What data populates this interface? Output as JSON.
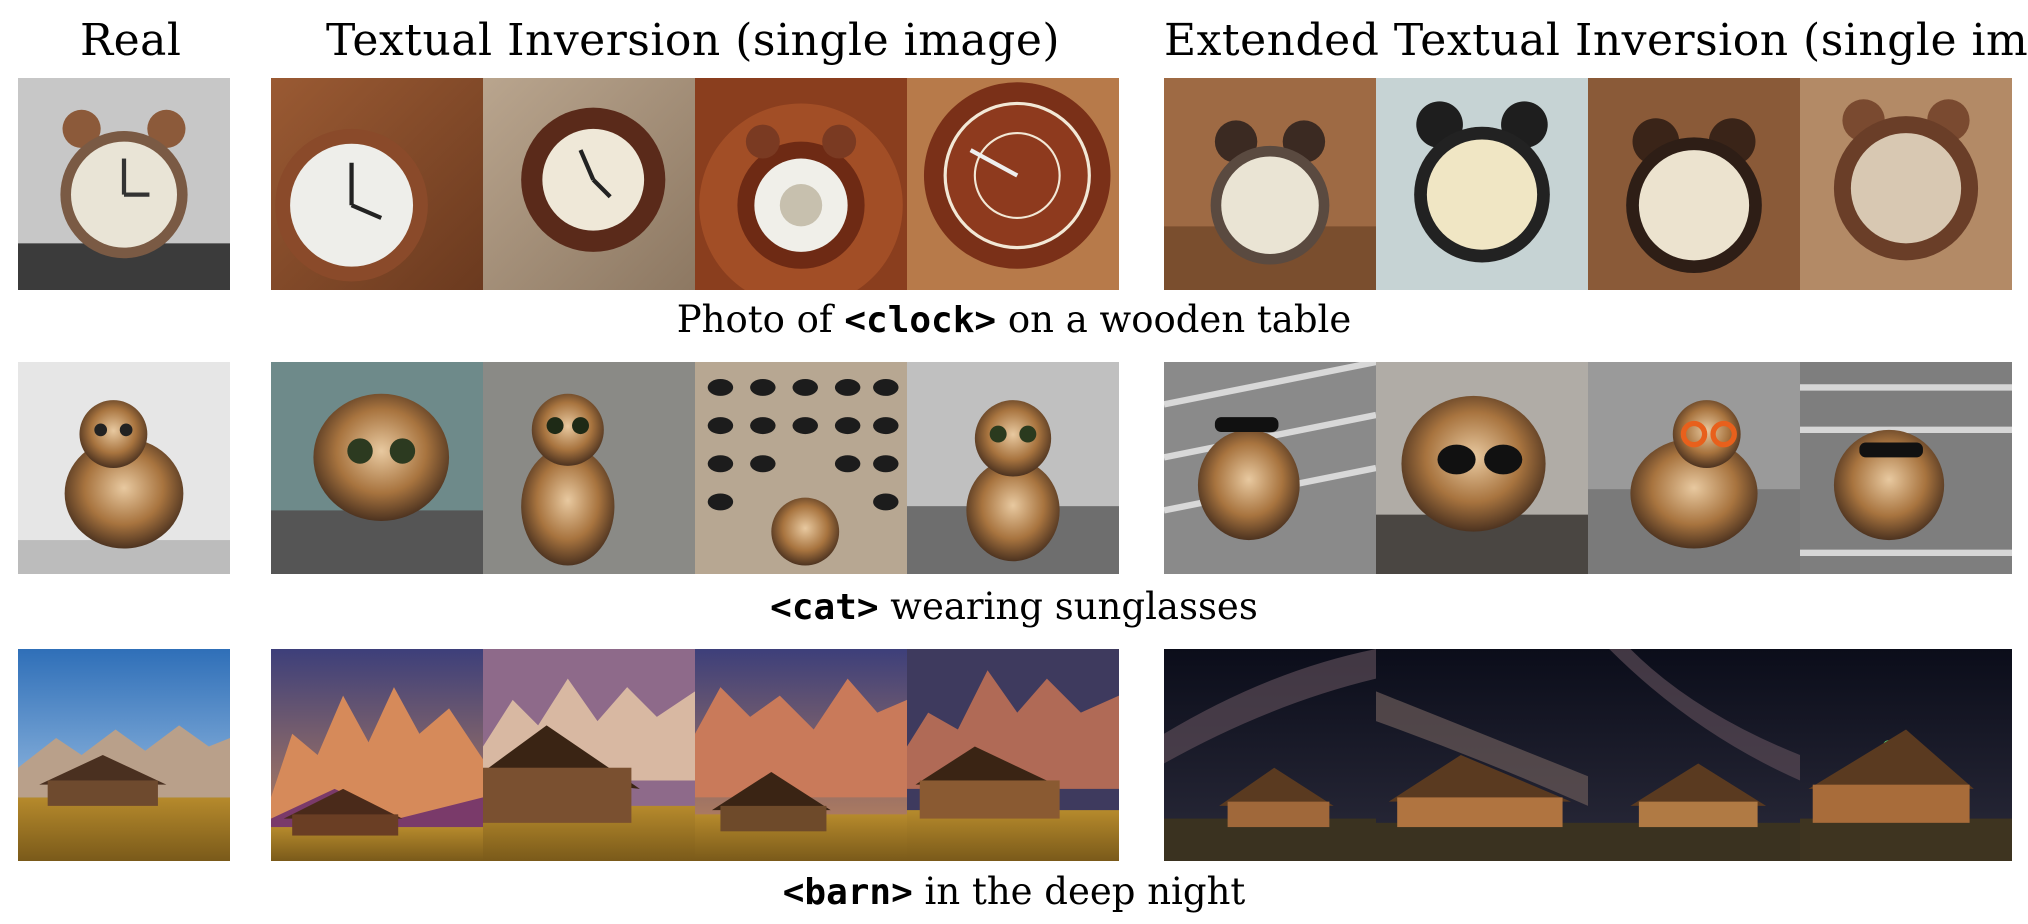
{
  "headers": {
    "real": "Real",
    "textual_inversion": "Textual Inversion (single image)",
    "extended_textual_inversion": "Extended Textual Inversion (single image)"
  },
  "rows": [
    {
      "caption_token": "<clock>",
      "caption_rest": " on a wooden table",
      "caption_prefix": "Photo of "
    },
    {
      "caption_token": "<cat>",
      "caption_rest": " wearing sunglasses",
      "caption_prefix": ""
    },
    {
      "caption_token": "<barn>",
      "caption_rest": " in the deep night",
      "caption_prefix": ""
    }
  ]
}
